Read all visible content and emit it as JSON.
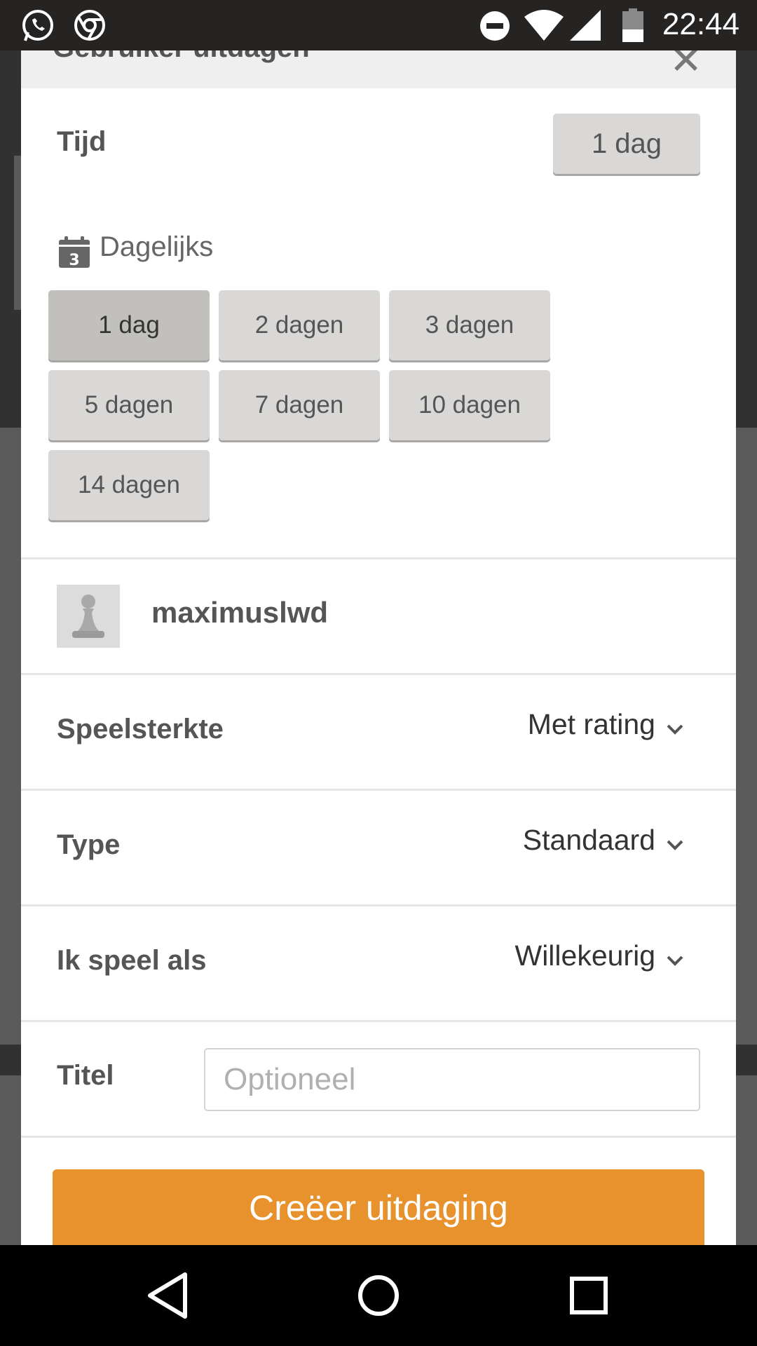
{
  "status_bar": {
    "time": "22:44",
    "icons": [
      "whatsapp-icon",
      "chrome-icon",
      "do-not-disturb-icon",
      "wifi-icon",
      "signal-icon",
      "battery-icon"
    ]
  },
  "modal": {
    "title": "Gebruiker uitdagen",
    "close_icon": "close-icon",
    "time": {
      "label": "Tijd",
      "selected_value": "1 dag"
    },
    "daily": {
      "icon": "calendar-icon",
      "calendar_icon_number": "3",
      "title": "Dagelijks",
      "options": [
        "1 dag",
        "2 dagen",
        "3 dagen",
        "5 dagen",
        "7 dagen",
        "10 dagen",
        "14 dagen"
      ],
      "selected_index": 0
    },
    "opponent": {
      "avatar_icon": "pawn-icon",
      "username": "maximuslwd"
    },
    "rating": {
      "label": "Speelsterkte",
      "value": "Met rating"
    },
    "type": {
      "label": "Type",
      "value": "Standaard"
    },
    "play_as": {
      "label": "Ik speel als",
      "value": "Willekeurig"
    },
    "title_field": {
      "label": "Titel",
      "placeholder": "Optioneel",
      "value": ""
    },
    "create_button": "Creëer uitdaging"
  },
  "colors": {
    "accent": "#e8922e",
    "button_bg": "#d9d8d6",
    "button_selected_bg": "#c1c0bd"
  },
  "navbar": {
    "icons": [
      "back-icon",
      "home-icon",
      "recents-icon"
    ]
  }
}
